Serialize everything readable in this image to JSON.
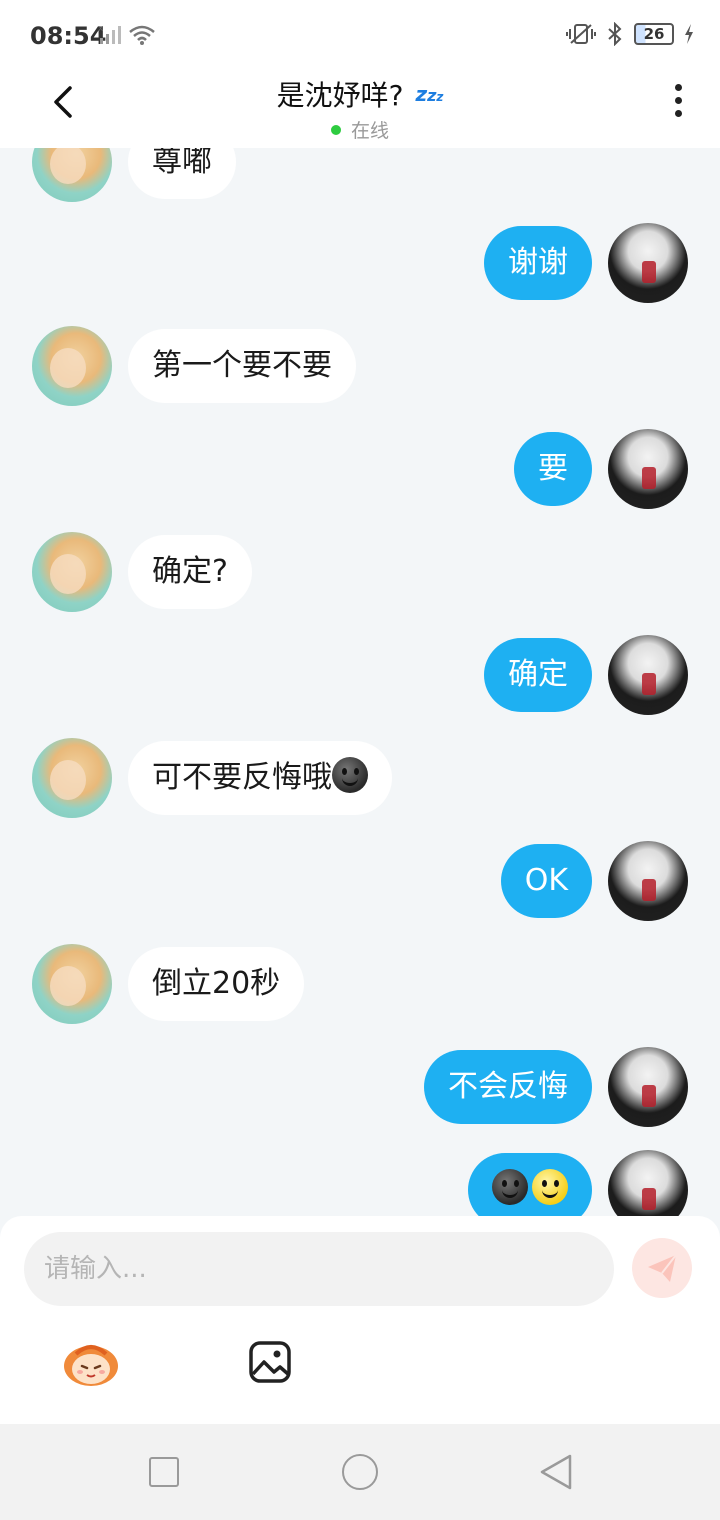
{
  "status_bar": {
    "time": "08:54",
    "battery": "26"
  },
  "header": {
    "title": "是沈妤咩?",
    "status": "在线"
  },
  "messages": [
    {
      "from": "other",
      "text": "尊嘟"
    },
    {
      "from": "me",
      "text": "谢谢"
    },
    {
      "from": "other",
      "text": "第一个要不要"
    },
    {
      "from": "me",
      "text": "要"
    },
    {
      "from": "other",
      "text": "确定?"
    },
    {
      "from": "me",
      "text": "确定"
    },
    {
      "from": "other",
      "text": "可不要反悔哦"
    },
    {
      "from": "me",
      "text": "OK"
    },
    {
      "from": "other",
      "text": "倒立20秒"
    },
    {
      "from": "me",
      "text": "不会反悔"
    },
    {
      "from": "me",
      "text": ""
    }
  ],
  "composer": {
    "placeholder": "请输入..."
  },
  "icons": {
    "send": "send-icon",
    "emoji": "emoji-icon",
    "image": "image-icon"
  },
  "colors": {
    "my_bubble": "#1eb0f2",
    "other_bubble": "#ffffff",
    "background": "#f3f6f8",
    "online": "#2ecc40"
  }
}
